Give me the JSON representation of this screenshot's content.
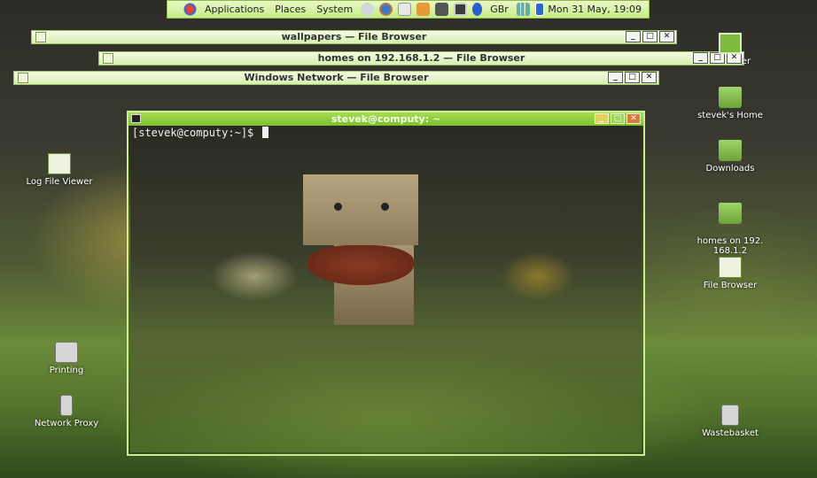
{
  "panel": {
    "menus": [
      "Applications",
      "Places",
      "System"
    ],
    "keyboard_layout": "GBr",
    "clock": "Mon 31 May, 19:09",
    "icons": [
      "gnome-foot-icon",
      "network-icon",
      "firefox-icon",
      "mail-icon",
      "package-icon",
      "terminal-icon",
      "display-icon",
      "bluetooth-icon",
      "signal-icon",
      "battery-icon"
    ]
  },
  "windows": [
    {
      "title": "wallpapers — File Browser"
    },
    {
      "title": "homes on 192.168.1.2 — File Browser"
    },
    {
      "title": "Windows Network — File Browser"
    }
  ],
  "terminal": {
    "title": "stevek@computy: ~",
    "prompt": "[stevek@computy:~]$"
  },
  "window_buttons": {
    "min": "_",
    "max": "□",
    "close": "✕"
  },
  "desktop_icons_left": [
    {
      "label": "Log File Viewer",
      "icon": "log-viewer-icon"
    },
    {
      "label": "Printing",
      "icon": "printer-icon"
    },
    {
      "label": "Network Proxy",
      "icon": "network-proxy-icon"
    }
  ],
  "desktop_icons_right": [
    {
      "label": "er",
      "icon": "computer-icon"
    },
    {
      "label": "stevek's Home",
      "icon": "home-folder-icon"
    },
    {
      "label": "Downloads",
      "icon": "folder-icon"
    },
    {
      "label": "homes on 192.\n168.1.2",
      "icon": "network-folder-icon"
    },
    {
      "label": "File Browser",
      "icon": "file-browser-icon"
    },
    {
      "label": "Wastebasket",
      "icon": "trash-icon"
    }
  ],
  "colors": {
    "accent": "#7ec130",
    "panel": "#d4f29f"
  }
}
